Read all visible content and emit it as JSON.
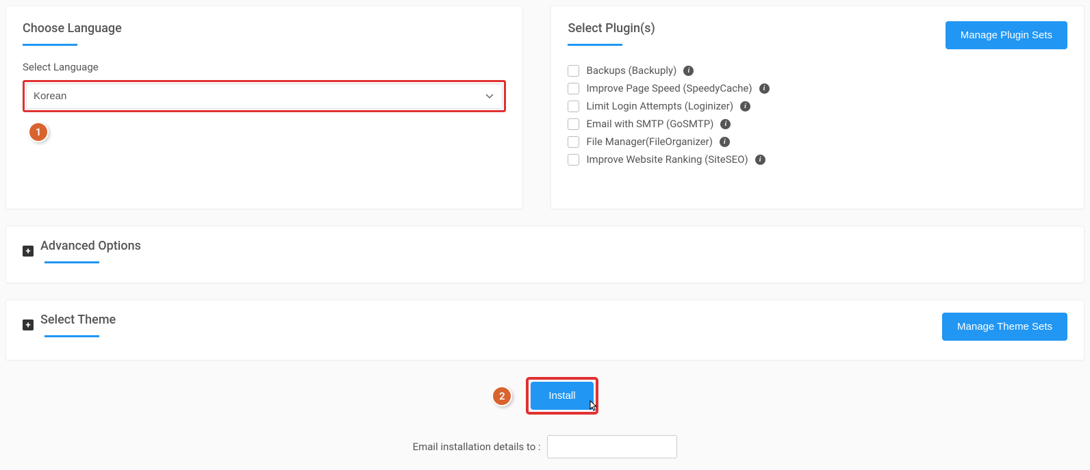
{
  "language": {
    "section_title": "Choose Language",
    "field_label": "Select Language",
    "selected_value": "Korean",
    "badge": "1"
  },
  "plugins": {
    "section_title": "Select Plugin(s)",
    "manage_button": "Manage Plugin Sets",
    "items": [
      {
        "label": "Backups (Backuply)"
      },
      {
        "label": "Improve Page Speed (SpeedyCache)"
      },
      {
        "label": "Limit Login Attempts (Loginizer)"
      },
      {
        "label": "Email with SMTP (GoSMTP)"
      },
      {
        "label": "File Manager(FileOrganizer)"
      },
      {
        "label": "Improve Website Ranking (SiteSEO)"
      }
    ]
  },
  "advanced": {
    "section_title": "Advanced Options"
  },
  "theme": {
    "section_title": "Select Theme",
    "manage_button": "Manage Theme Sets"
  },
  "install": {
    "badge": "2",
    "button_label": "Install"
  },
  "email": {
    "label": "Email installation details to :",
    "value": ""
  }
}
